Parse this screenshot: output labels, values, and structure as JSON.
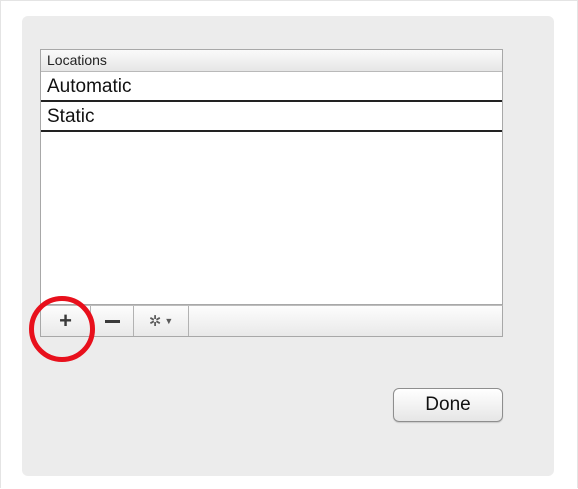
{
  "locations_table": {
    "header": "Locations",
    "rows": [
      "Automatic",
      "Static"
    ]
  },
  "toolbar": {
    "add_label": "+",
    "remove_icon": "minus-icon",
    "action_icon": "gear-icon",
    "dropdown_icon": "triangle-down-icon"
  },
  "done_button": {
    "label": "Done"
  },
  "annotation": {
    "highlight_color": "#e8101c",
    "highlight_icon": "red-circle"
  }
}
